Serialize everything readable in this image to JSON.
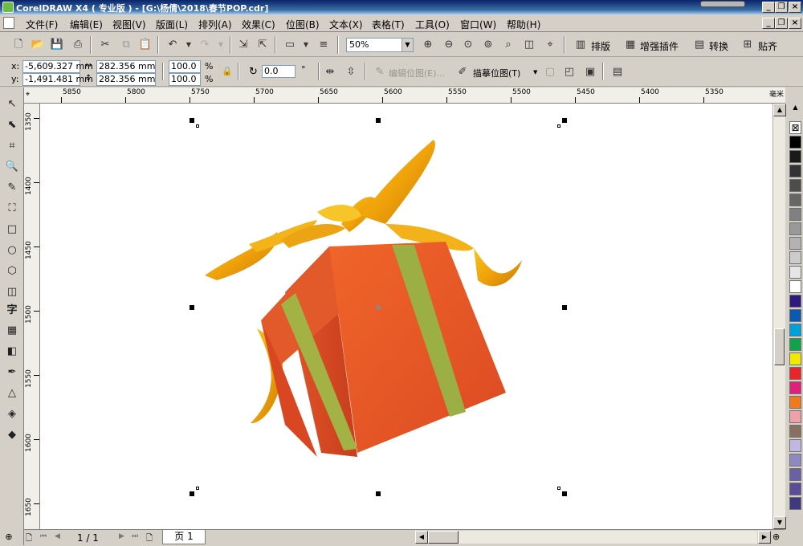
{
  "window": {
    "title": "CorelDRAW X4 ( 专业版 ) - [G:\\杨倩\\2018\\春节POP.cdr]"
  },
  "menu": [
    "文件(F)",
    "编辑(E)",
    "视图(V)",
    "版面(L)",
    "排列(A)",
    "效果(C)",
    "位图(B)",
    "文本(X)",
    "表格(T)",
    "工具(O)",
    "窗口(W)",
    "帮助(H)"
  ],
  "toolbar": {
    "zoom": "50%",
    "layout_label": "排版",
    "plugin_label": "增强插件",
    "convert_label": "转换",
    "align_label": "贴齐"
  },
  "property_bar": {
    "x_label": "x:",
    "y_label": "y:",
    "x": "-5,609.327 mm",
    "y": "-1,491.481 mm",
    "width": "282.356 mm",
    "height": "282.356 mm",
    "scale_x": "100.0",
    "scale_y": "100.0",
    "percent": "%",
    "rotation": "0.0",
    "degree": "°",
    "edit_bitmap": "编辑位图(E)...",
    "trace_bitmap": "描摹位图(T)"
  },
  "ruler": {
    "unit": "毫米",
    "h_labels": [
      "5850",
      "5800",
      "5750",
      "5700",
      "5650",
      "5600",
      "5550",
      "5500",
      "5450",
      "5400",
      "5350"
    ],
    "v_labels": [
      "1350",
      "1400",
      "1450",
      "1500",
      "1550",
      "1600",
      "1650"
    ]
  },
  "page_nav": {
    "counter": "1 / 1",
    "tab": "页 1"
  },
  "palette": {
    "colors": [
      "#000000",
      "#1a1a1a",
      "#333333",
      "#4d4d4d",
      "#666666",
      "#808080",
      "#999999",
      "#b3b3b3",
      "#cccccc",
      "#e6e6e6",
      "#ffffff",
      "#2e1a7d",
      "#0a58b0",
      "#00a0d8",
      "#12a34a",
      "#f5e800",
      "#e8262a",
      "#e0207a",
      "#f07a1c",
      "#f0a0a8",
      "#8a7060",
      "#c0b8e0",
      "#9088c0",
      "#6a60a8",
      "#5a4c98",
      "#403880"
    ]
  }
}
